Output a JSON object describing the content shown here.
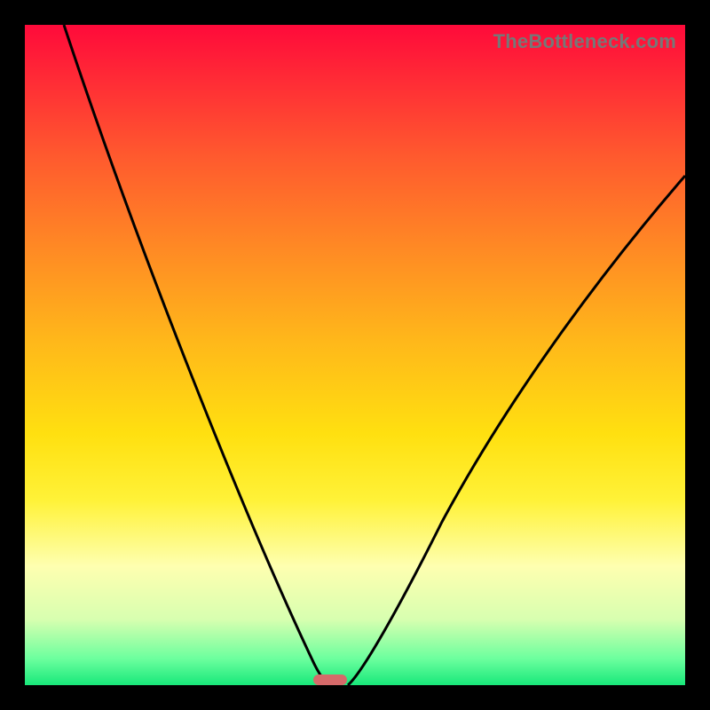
{
  "watermark": "TheBottleneck.com",
  "chart_data": {
    "type": "line",
    "title": "",
    "xlabel": "",
    "ylabel": "",
    "xlim": [
      0,
      100
    ],
    "ylim": [
      0,
      100
    ],
    "grid": false,
    "legend": false,
    "series": [
      {
        "name": "left-branch",
        "x": [
          5,
          10,
          15,
          20,
          25,
          30,
          35,
          40,
          43,
          46
        ],
        "y": [
          100,
          83,
          67,
          52,
          40,
          28,
          18,
          8,
          2,
          0
        ]
      },
      {
        "name": "right-branch",
        "x": [
          49,
          52,
          56,
          62,
          70,
          80,
          90,
          100
        ],
        "y": [
          0,
          3,
          9,
          20,
          35,
          52,
          67,
          78
        ]
      }
    ],
    "marker": {
      "x_start": 44,
      "x_end": 49,
      "y": 0
    },
    "background_gradient": {
      "top": "#ff0a3a",
      "mid": "#ffe010",
      "bottom": "#18e87a"
    }
  }
}
